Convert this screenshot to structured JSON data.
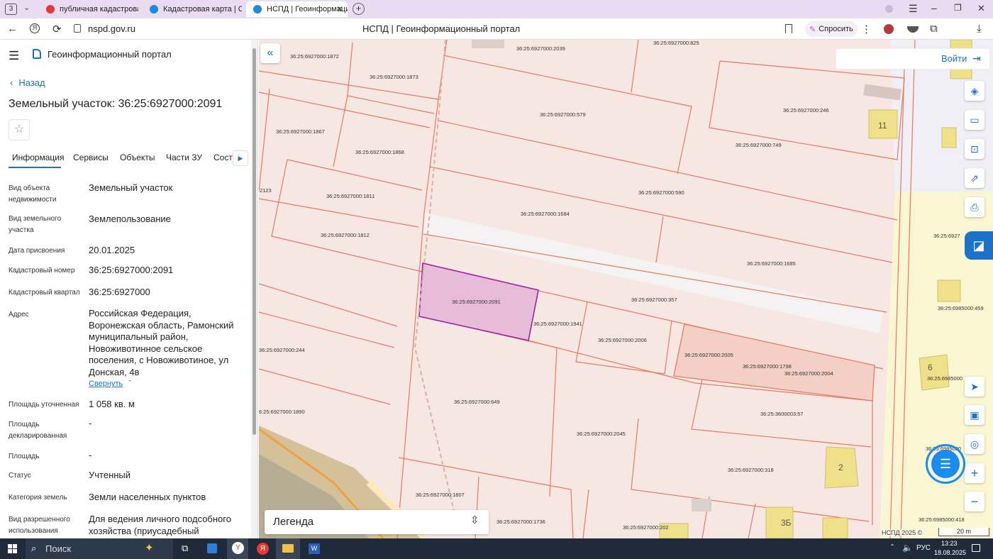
{
  "browser": {
    "tab_counter": "3",
    "tabs": [
      {
        "title": "публичная кадастровая к",
        "icon": "yandex-icon",
        "active": false
      },
      {
        "title": "Кадастровая карта | Серв",
        "icon": "portal-icon",
        "active": false
      },
      {
        "title": "НСПД | Геоинформацио",
        "icon": "portal-icon",
        "active": true
      }
    ],
    "url": "nspd.gov.ru",
    "page_title": "НСПД | Геоинформационный портал",
    "ask_label": "Спросить"
  },
  "sidebar": {
    "portal_title": "Геоинформационный портал",
    "back_label": "Назад",
    "heading": "Земельный участок: 36:25:6927000:2091",
    "tabs": [
      "Информация",
      "Сервисы",
      "Объекты",
      "Части ЗУ",
      "Соста"
    ],
    "active_tab": "Информация",
    "fields": [
      {
        "label": "Вид объекта недвижимости",
        "value": "Земельный участок"
      },
      {
        "label": "Вид земельного участка",
        "value": "Землепользование"
      },
      {
        "label": "Дата присвоения",
        "value": "20.01.2025"
      },
      {
        "label": "Кадастровый номер",
        "value": "36:25:6927000:2091"
      },
      {
        "label": "Кадастровый квартал",
        "value": "36:25:6927000"
      },
      {
        "label": "Адрес",
        "value": "Российская Федерация, Воронежская область, Рамонский муниципальный район, Новоживотинное сельское поселения, с Новоживотиное, ул Донская, 4в"
      },
      {
        "label": "Площадь уточненная",
        "value": "1 058 кв. м"
      },
      {
        "label": "Площадь декларированная",
        "value": "-"
      },
      {
        "label": "Площадь",
        "value": "-"
      },
      {
        "label": "Статус",
        "value": "Учтенный"
      },
      {
        "label": "Категория земель",
        "value": "Земли населенных пунктов"
      },
      {
        "label": "Вид разрешенного использования",
        "value": "Для ведения личного подсобного хозяйства (приусадебный земельный"
      }
    ],
    "collapse_label": "Свернуть"
  },
  "map": {
    "login_label": "Войти",
    "legend_label": "Легенда",
    "copyright": "НСПД 2025 ©",
    "scale_label": "20 m",
    "parcel_labels": [
      "36:25:6927000:2039",
      "36:25:6927000:825",
      "36:25:6927000:1872",
      "36:25:6927000:1873",
      "36:25:6927000:579",
      "36:25:6927000:246",
      "36:25:6927000:1867",
      "36:25:6927000:1868",
      "36:25:6927000:749",
      "36:25:6927000:590",
      "36:25:6927000:1811",
      "36:25:6927000:1684",
      "36:25:6927000:1812",
      "36:25:6927000:1685",
      "36:25:6927000:2091",
      "36:25:6927000:357",
      "36:25:6927000:1941",
      "36:25:6927000:2006",
      "36:25:6927000:244",
      "36:25:6927000:2005",
      "36:25:6927000:1798",
      "36:25:6927000:2004",
      "36:25:6927000:649",
      "36:25:3600003:57",
      "6:25:6927000:1890",
      "36:25:6927000:2045",
      "36:25:6927000:318",
      "36:25:6927000:1807",
      "36:25:6927000:1736",
      "36:25:6927000:202",
      "36:25:6985000:418",
      "36:25:6985000:459",
      "36:25:6985000",
      "2123",
      "36:25:6985080",
      "36:25:6927"
    ],
    "building_numbers": [
      "11",
      "6",
      "2",
      "3Б"
    ]
  },
  "taskbar": {
    "search_label": "Поиск",
    "lang": "РУС",
    "time": "13:23",
    "date": "18.08.2025"
  },
  "colors": {
    "parcel_line": "#e8785e",
    "selected_fill": "#e6bcd8",
    "selected_line": "#a020a0",
    "accent": "#1a73c7"
  }
}
